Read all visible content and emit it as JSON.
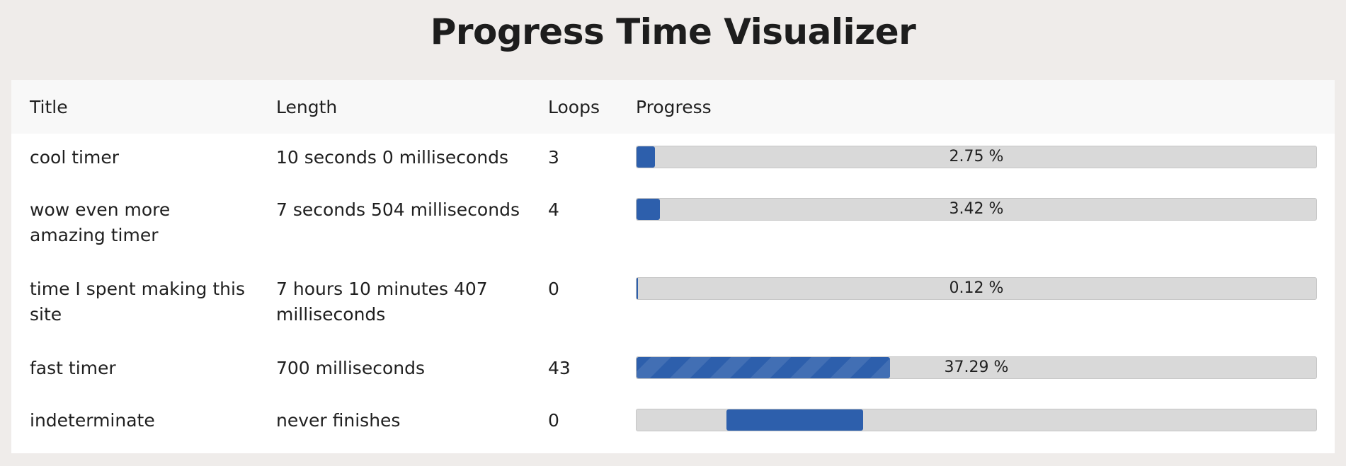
{
  "page": {
    "title": "Progress Time Visualizer"
  },
  "table": {
    "headers": {
      "title": "Title",
      "length": "Length",
      "loops": "Loops",
      "progress": "Progress"
    },
    "rows": [
      {
        "title": "cool timer",
        "length": "10 seconds 0 milliseconds",
        "loops": "3",
        "progress_label": "2.75 %",
        "progress": 0.0275,
        "striped": false,
        "indeterminate": false
      },
      {
        "title": "wow even more amazing timer",
        "length": "7 seconds 504 milliseconds",
        "loops": "4",
        "progress_label": "3.42 %",
        "progress": 0.0342,
        "striped": false,
        "indeterminate": false
      },
      {
        "title": "time I spent making this site",
        "length": "7 hours 10 minutes 407 milliseconds",
        "loops": "0",
        "progress_label": "0.12 %",
        "progress": 0.0012,
        "striped": false,
        "indeterminate": false
      },
      {
        "title": "fast timer",
        "length": "700 milliseconds",
        "loops": "43",
        "progress_label": "37.29 %",
        "progress": 0.3729,
        "striped": true,
        "indeterminate": false
      },
      {
        "title": "indeterminate",
        "length": "never finishes",
        "loops": "0",
        "progress_label": "",
        "progress": null,
        "striped": false,
        "indeterminate": true
      }
    ]
  },
  "colors": {
    "background": "#efecea",
    "card": "#ffffff",
    "header_row": "#f8f8f8",
    "bar_track": "#d9d9d9",
    "bar_fill": "#2d5fac"
  }
}
